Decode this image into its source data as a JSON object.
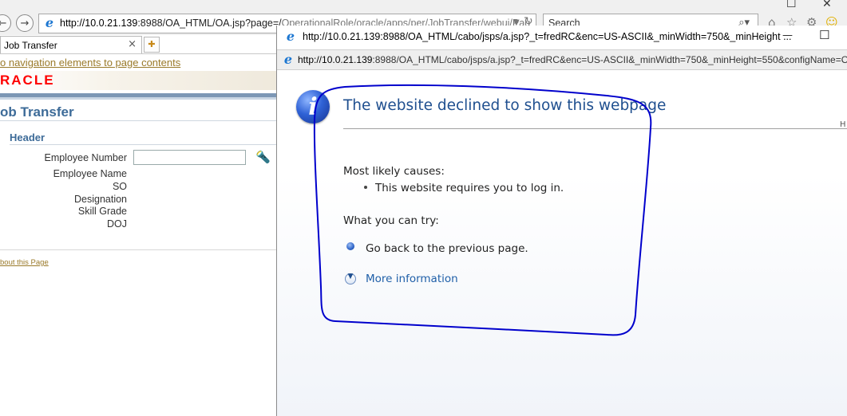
{
  "background_browser": {
    "address_host": "http://10.0.21.139",
    "address_rest": ":8988/OA_HTML/OA.jsp?page=/",
    "address_tail": "OperationalRole/oracle/apps/per/JobTransfer/webui/Pag",
    "search_placeholder": "Search",
    "tab_label": "Job Transfer",
    "tab_close": "×",
    "skip_link": "o navigation elements to page contents",
    "logo_text": "RACLE",
    "page_title": "ob Transfer",
    "section_header": "Header",
    "fields": [
      {
        "label": "Employee Number"
      },
      {
        "label": "Employee Name"
      },
      {
        "label": "SO"
      },
      {
        "label": "Designation"
      },
      {
        "label": "Skill Grade"
      },
      {
        "label": "DOJ"
      }
    ],
    "about_link": "bout this Page"
  },
  "popup": {
    "title_bar": "http://10.0.21.139:8988/OA_HTML/cabo/jsps/a.jsp?_t=fredRC&enc=US-ASCII&_minWidth=750&_minHeight ...",
    "address_host": "http://10.0.21.139",
    "address_rest": ":8988/OA_HTML/cabo/jsps/a.jsp?_t=fredRC&enc=US-ASCII&_minWidth=750&_minHeight=550&configName=O",
    "minimize": "—",
    "maximize": "☐",
    "heading": "The website declined to show this webpage",
    "ht_fragment": "H",
    "causes_heading": "Most likely causes:",
    "cause_1": "This website requires you to log in.",
    "try_heading": "What you can try:",
    "try_1": "Go back to the previous page.",
    "more_info": "More information"
  },
  "colors": {
    "annotation_stroke": "#0000cc",
    "heading": "#1f4f8f",
    "link": "#1f5fa8",
    "oracle_red": "#ff0000"
  }
}
